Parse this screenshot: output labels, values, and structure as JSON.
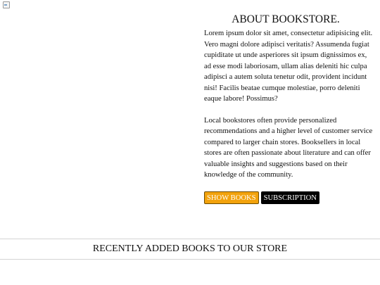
{
  "about": {
    "title": "ABOUT BOOKSTORE.",
    "paragraph1": [
      "Lorem ipsum dolor sit amet, consectetur adipisicing elit.",
      "Vero magni dolore adipisci veritatis? Assumenda fugiat",
      "cupiditate ut unde asperiores sit ipsum dignissimos ex,",
      "ad esse modi laboriosam, ullam alias deleniti hic culpa",
      "adipisci a autem soluta tenetur odit, provident incidunt",
      "nisi! Facilis beatae cumque molestiae, porro deleniti",
      "eaque labore! Possimus?"
    ],
    "paragraph2": [
      "Local bookstores often provide personalized",
      "recommendations and a higher level of customer service",
      "compared to larger chain stores. Booksellers in local",
      "stores are often passionate about literature and can offer",
      "valuable insights and suggestions based on their",
      "knowledge of the community."
    ],
    "buttons": {
      "show_books": "SHOW BOOKS",
      "subscription": "SUBSCRIPTION"
    }
  },
  "recent": {
    "title": "RECENTLY ADDED BOOKS TO OUR STORE"
  },
  "colors": {
    "show_books_bg": "#f2a20c",
    "subscription_bg": "#000000"
  },
  "icons": {
    "hero_image": "broken-image-icon"
  }
}
